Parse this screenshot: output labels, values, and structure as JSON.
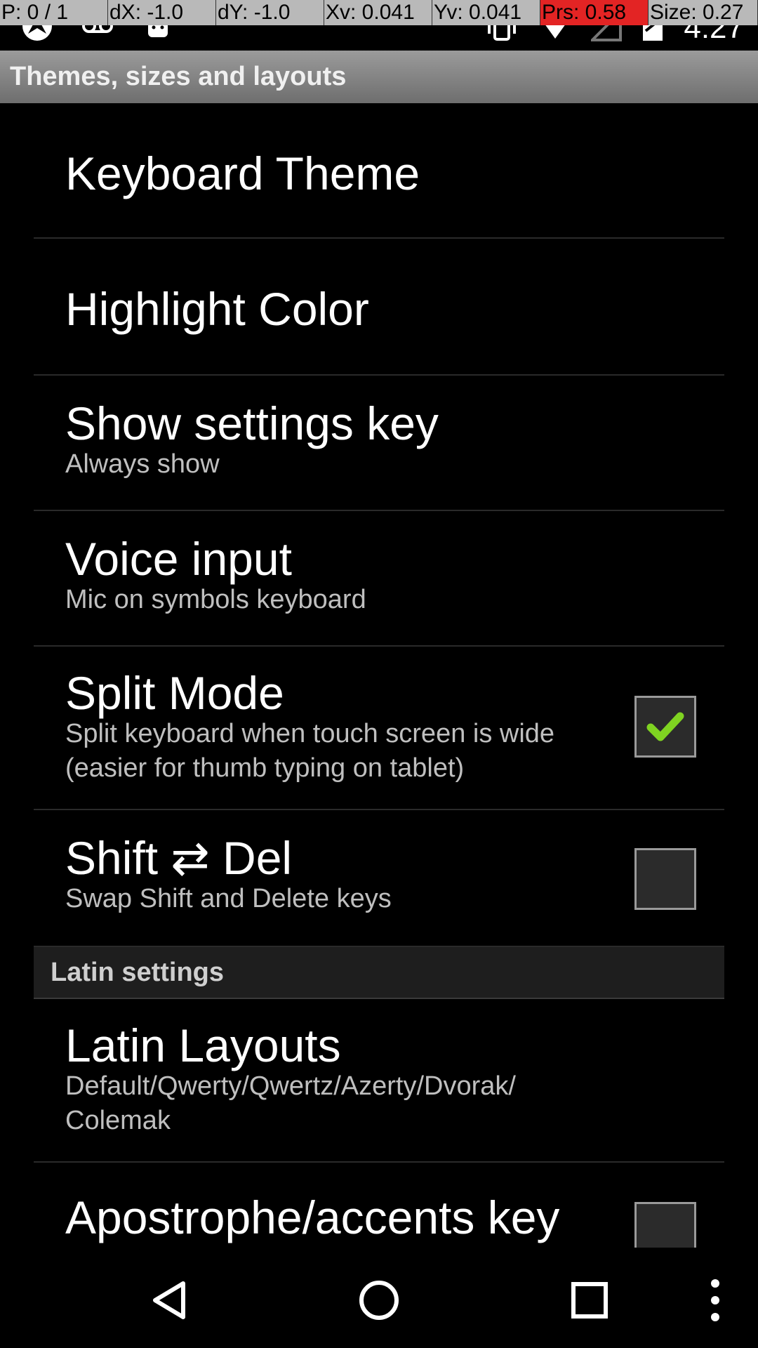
{
  "debug_bar": {
    "p": "P: 0 / 1",
    "dx": "dX: -1.0",
    "dy": "dY: -1.0",
    "xv": "Xv: 0.041",
    "yv": "Yv: 0.041",
    "prs": "Prs: 0.58",
    "size": "Size: 0.27"
  },
  "status": {
    "time": "4:27",
    "icons": [
      "phoenix-icon",
      "voicemail-icon",
      "android-icon",
      "vibrate-icon",
      "wifi-icon",
      "signal-icon",
      "battery-icon"
    ]
  },
  "header": {
    "title": "Themes, sizes and layouts"
  },
  "prefs": [
    {
      "title": "Keyboard Theme"
    },
    {
      "title": "Highlight Color"
    },
    {
      "title": "Show settings key",
      "summary": "Always show"
    },
    {
      "title": "Voice input",
      "summary": "Mic on symbols keyboard"
    },
    {
      "title": "Split Mode",
      "summary": "Split keyboard when touch screen is wide (easier for thumb typing on tablet)",
      "checked": true
    },
    {
      "title": "Shift ⇄ Del",
      "summary": "Swap Shift and Delete keys",
      "checked": false
    }
  ],
  "section": {
    "title": "Latin settings"
  },
  "latin": [
    {
      "title": "Latin Layouts",
      "summary": "Default/Qwerty/Qwertz/Azerty/Dvorak/ Colemak"
    },
    {
      "title": "Apostrophe/accents key",
      "checked": false
    }
  ],
  "colors": {
    "check_green": "#7fd321",
    "background": "#000000",
    "divider": "#2a2a2a"
  },
  "navbar": {
    "icons": [
      "back-icon",
      "home-icon",
      "recents-icon",
      "overflow-menu-icon"
    ]
  }
}
